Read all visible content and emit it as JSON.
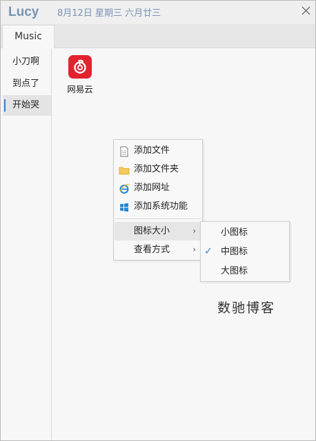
{
  "title": {
    "app_name": "Lucy",
    "date": "8月12日 星期三 六月廿三"
  },
  "tabs": [
    {
      "label": "Music"
    }
  ],
  "sidebar": {
    "items": [
      {
        "label": "小刀啊"
      },
      {
        "label": "到点了"
      },
      {
        "label": "开始哭"
      }
    ],
    "active_index": 2
  },
  "apps": [
    {
      "label": "网易云",
      "icon": "netease-cloud-music-icon",
      "color": "#e2232f"
    }
  ],
  "context_menu": {
    "items": [
      {
        "label": "添加文件",
        "icon": "file-icon"
      },
      {
        "label": "添加文件夹",
        "icon": "folder-icon"
      },
      {
        "label": "添加网址",
        "icon": "ie-browser-icon"
      },
      {
        "label": "添加系统功能",
        "icon": "windows-icon"
      },
      {
        "label": "图标大小",
        "arrow": "›"
      },
      {
        "label": "查看方式",
        "arrow": "›"
      }
    ]
  },
  "submenu": {
    "items": [
      {
        "label": "小图标"
      },
      {
        "label": "中图标",
        "checked": true
      },
      {
        "label": "大图标"
      }
    ],
    "check_mark": "✓"
  },
  "watermark": "数驰博客",
  "colors": {
    "accent": "#3d7cc9",
    "title_text": "#7893b3",
    "app_red": "#e2232f"
  }
}
